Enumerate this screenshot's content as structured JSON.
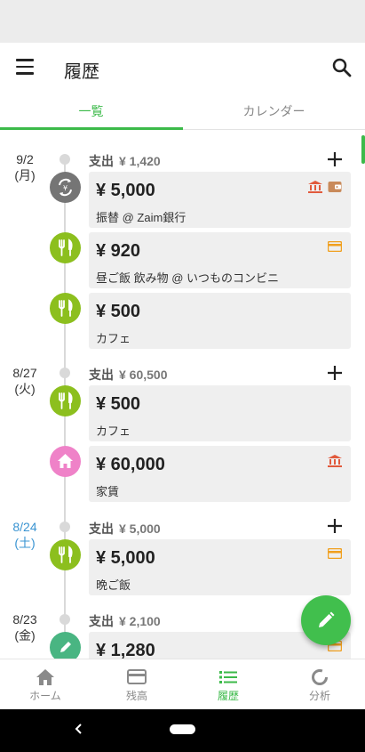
{
  "header": {
    "title": "履歴"
  },
  "tabs": [
    {
      "label": "一覧",
      "active": true
    },
    {
      "label": "カレンダー",
      "active": false
    }
  ],
  "days": [
    {
      "date": "9/2",
      "weekday": "(月)",
      "sum_label": "支出",
      "sum_value": "¥ 1,420",
      "entries": [
        {
          "amount": "¥ 5,000",
          "desc": "振替 @ Zaim銀行",
          "category_icon": "transfer-icon",
          "account_icons": [
            "bank-icon",
            "wallet-icon"
          ]
        },
        {
          "amount": "¥ 920",
          "desc": "昼ご飯 飲み物 @ いつものコンビニ",
          "category_icon": "fork-knife-icon",
          "account_icons": [
            "card-icon"
          ]
        },
        {
          "amount": "¥ 500",
          "desc": "カフェ",
          "category_icon": "fork-knife-icon",
          "account_icons": []
        }
      ]
    },
    {
      "date": "8/27",
      "weekday": "(火)",
      "sum_label": "支出",
      "sum_value": "¥ 60,500",
      "entries": [
        {
          "amount": "¥ 500",
          "desc": "カフェ",
          "category_icon": "fork-knife-icon",
          "account_icons": []
        },
        {
          "amount": "¥ 60,000",
          "desc": "家賃",
          "category_icon": "house-icon",
          "account_icons": [
            "bank-icon"
          ]
        }
      ]
    },
    {
      "date": "8/24",
      "weekday": "(土)",
      "sum_label": "支出",
      "sum_value": "¥ 5,000",
      "entries": [
        {
          "amount": "¥ 5,000",
          "desc": "晩ご飯",
          "category_icon": "fork-knife-icon",
          "account_icons": [
            "card-icon"
          ]
        }
      ]
    },
    {
      "date": "8/23",
      "weekday": "(金)",
      "sum_label": "支出",
      "sum_value": "¥ 2,100",
      "entries": [
        {
          "amount": "¥ 1,280",
          "desc": "",
          "category_icon": "pencil-icon",
          "account_icons": [
            "card-icon"
          ]
        }
      ]
    }
  ],
  "bottom_nav": [
    {
      "label": "ホーム",
      "icon": "home-icon",
      "active": false
    },
    {
      "label": "残高",
      "icon": "card-icon",
      "active": false
    },
    {
      "label": "履歴",
      "icon": "list-icon",
      "active": true
    },
    {
      "label": "分析",
      "icon": "donut-chart-icon",
      "active": false
    }
  ],
  "colors": {
    "accent": "#3cba4a",
    "saturday": "#3a94d2",
    "bank_icon": "#e15a3c",
    "card_icon": "#f0a020",
    "food": "#8cbf1e",
    "home": "#ef82c8",
    "transfer": "#757575"
  }
}
